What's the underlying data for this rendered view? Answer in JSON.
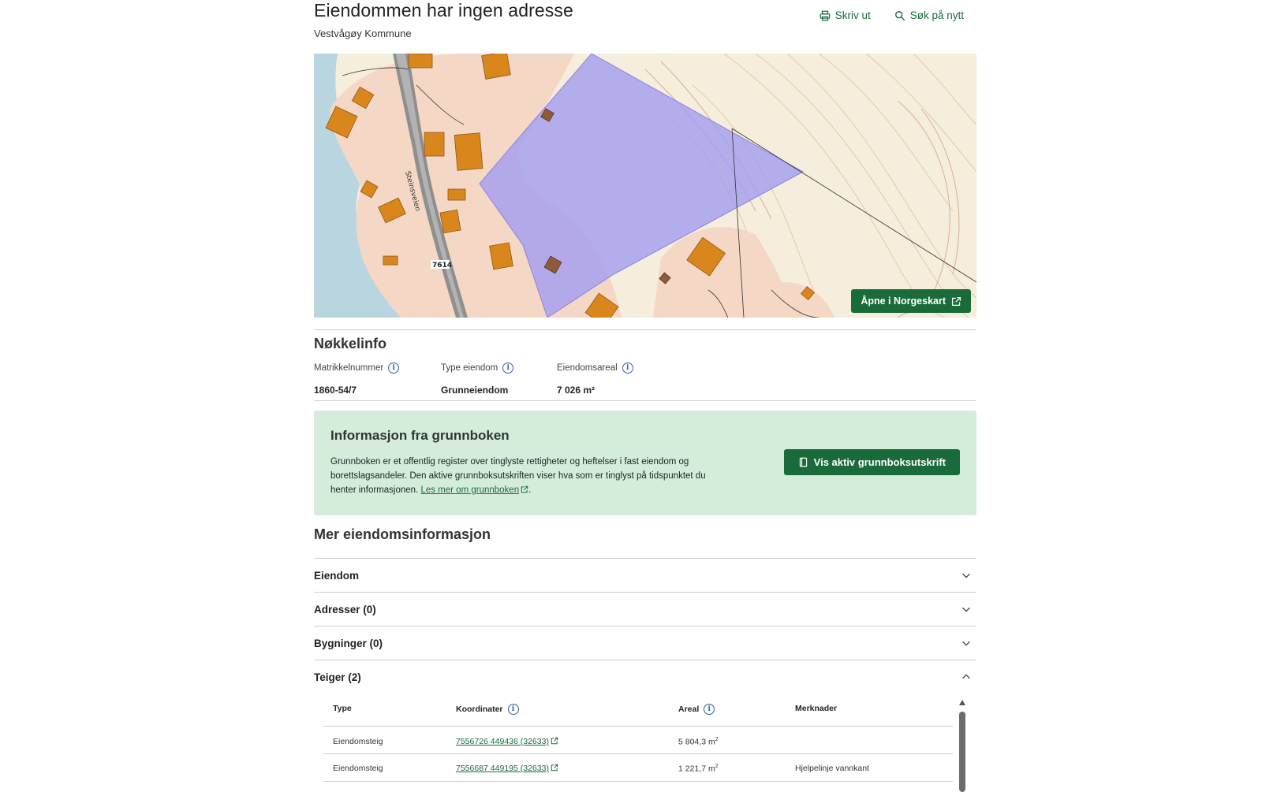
{
  "header": {
    "title": "Eiendommen har ingen adresse",
    "subtitle": "Vestvågøy Kommune",
    "print_label": "Skriv ut",
    "search_again_label": "Søk på nytt",
    "print_icon": "printer-icon",
    "search_icon": "search-icon"
  },
  "map": {
    "open_button_label": "Åpne i Norgeskart",
    "road_label": "Steinsveien",
    "road_number": "7614",
    "colors": {
      "property": "#a39cf0",
      "buildings": "#d9861c",
      "water": "#b9d6e0",
      "residential": "#f5d7c6",
      "terrain": "#f5eedc"
    }
  },
  "key_info": {
    "title": "Nøkkelinfo",
    "items": [
      {
        "label": "Matrikkelnummer",
        "value": "1860-54/7"
      },
      {
        "label": "Type eiendom",
        "value": "Grunneiendom"
      },
      {
        "label": "Eiendomsareal",
        "value": "7 026 m²"
      }
    ]
  },
  "grunnbok": {
    "title": "Informasjon fra grunnboken",
    "text_line1": "Grunnboken er et offentlig register over tinglyste rettigheter og heftelser i fast eiendom og",
    "text_line2": "borettslagsandeler. Den aktive grunnboksutskriften viser hva som er tinglyst på tidspunktet du",
    "text_line3": "henter informasjonen.",
    "link_label": "Les mer om grunnboken",
    "button_label": "Vis aktiv grunnboksutskrift"
  },
  "more_info": {
    "title": "Mer eiendomsinformasjon",
    "sections": [
      {
        "label": "Eiendom",
        "expanded": false
      },
      {
        "label": "Adresser (0)",
        "expanded": false
      },
      {
        "label": "Bygninger (0)",
        "expanded": false
      },
      {
        "label": "Teiger (2)",
        "expanded": true
      }
    ]
  },
  "teiger": {
    "columns": [
      "Type",
      "Koordinater",
      "Areal",
      "Merknader"
    ],
    "rows": [
      {
        "type": "Eiendomsteig",
        "coords": "7556726 449436 (32633)",
        "area": "5 804,3 m",
        "area_sup": "2",
        "note": ""
      },
      {
        "type": "Eiendomsteig",
        "coords": "7556687 449195 (32633)",
        "area": "1 221,7 m",
        "area_sup": "2",
        "note": "Hjelpelinje vannkant"
      }
    ]
  }
}
